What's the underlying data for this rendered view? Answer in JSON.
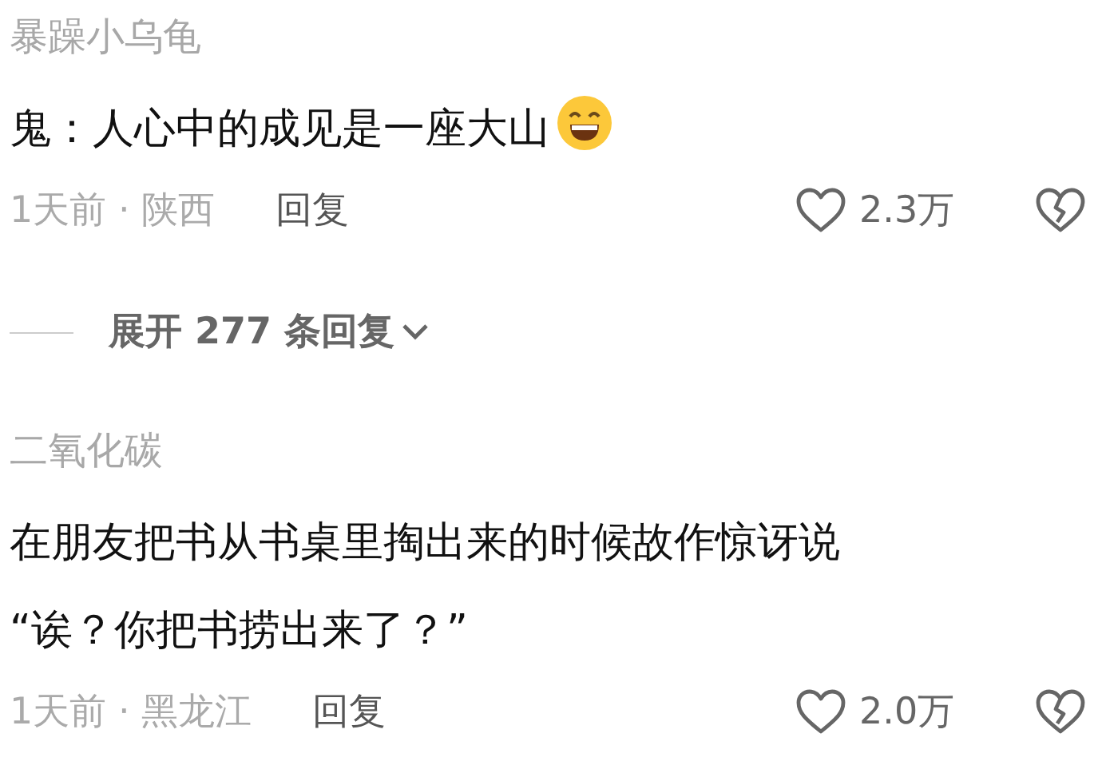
{
  "comments": [
    {
      "username": "暴躁小乌龟",
      "text": "鬼：人心中的成见是一座大山",
      "emoji": true,
      "time_location": "1天前 · 陕西",
      "reply": "回复",
      "likes": "2.3万",
      "expand_replies": "展开 277 条回复"
    },
    {
      "username": "二氧化碳",
      "text": "在朋友把书从书桌里掏出来的时候故作惊讶说\n“诶？你把书捞出来了？”",
      "emoji": false,
      "time_location": "1天前 · 黑龙江",
      "reply": "回复",
      "likes": "2.0万"
    }
  ]
}
